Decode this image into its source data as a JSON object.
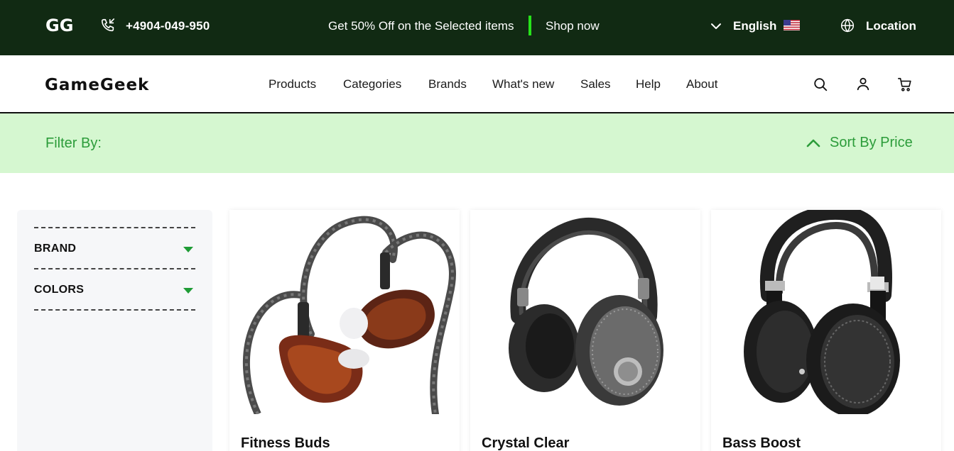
{
  "topbar": {
    "logo_text": "GG",
    "phone": "+4904-049-950",
    "promo": "Get 50% Off on the Selected items",
    "shop_now": "Shop now",
    "language": "English",
    "location": "Location",
    "colors": {
      "background": "#112a13",
      "accent": "#27e21b"
    }
  },
  "header": {
    "brand": "GameGeek",
    "nav": [
      "Products",
      "Categories",
      "Brands",
      "What's new",
      "Sales",
      "Help",
      "About"
    ],
    "icons": [
      "search-icon",
      "user-icon",
      "cart-icon"
    ]
  },
  "filterbar": {
    "filter_label": "Filter By:",
    "sort_label": "Sort By Price",
    "colors": {
      "background": "#d5f7d0",
      "text": "#2c9c3a"
    }
  },
  "sidebar": {
    "facets": [
      {
        "label": "BRAND"
      },
      {
        "label": "COLORS"
      }
    ]
  },
  "products": [
    {
      "title": "Fitness Buds",
      "image": "in-ear-monitor-earphones"
    },
    {
      "title": "Crystal Clear",
      "image": "over-ear-headphones-black"
    },
    {
      "title": "Bass Boost",
      "image": "planar-magnetic-headphones"
    }
  ]
}
